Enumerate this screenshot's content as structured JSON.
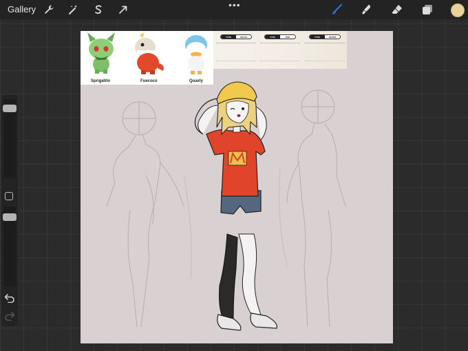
{
  "toolbar": {
    "gallery_label": "Gallery",
    "tools": [
      "wrench-icon",
      "magic-wand-icon",
      "selection-s-icon",
      "transform-arrow-icon"
    ],
    "more_label": "•••",
    "right_tools": [
      "brush-icon",
      "smudge-icon",
      "eraser-icon",
      "layers-icon"
    ],
    "active_color": "#e8d49a",
    "brush_color": "#2b6fe0"
  },
  "sidebar": {
    "brush_size_level": 0.05,
    "opacity_level": 0.0
  },
  "reference": {
    "names": [
      "Sprigatito",
      "Fuecoco",
      "Quaxly"
    ],
    "types": [
      {
        "key": "TYPE",
        "value": "GRASS"
      },
      {
        "key": "TYPE",
        "value": "FIRE"
      },
      {
        "key": "TYPE",
        "value": "WATER"
      }
    ]
  }
}
